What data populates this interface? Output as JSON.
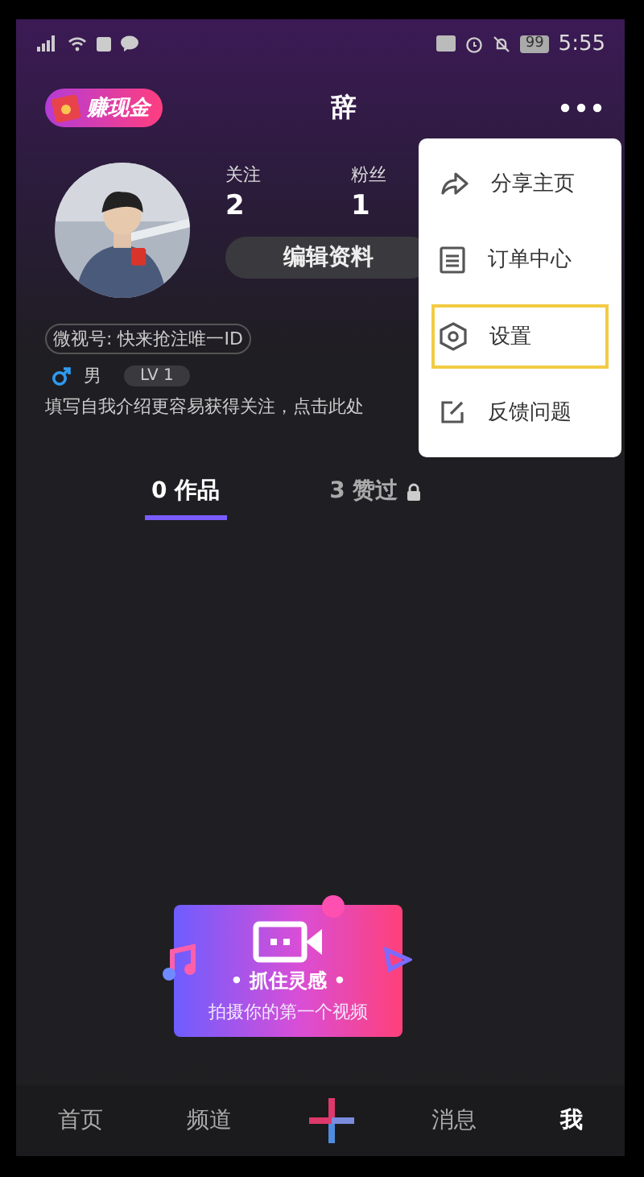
{
  "status_bar": {
    "battery": "99",
    "time": "5:55"
  },
  "header": {
    "badge": "赚现金",
    "title": "辞"
  },
  "profile": {
    "stats": [
      {
        "label": "关注",
        "value": "2"
      },
      {
        "label": "粉丝",
        "value": "1"
      }
    ],
    "edit_button": "编辑资料",
    "id_label": "微视号: 快来抢注唯一ID",
    "gender": "男",
    "level_badge": "LV 1",
    "bio": "填写自我介绍更容易获得关注，点击此处"
  },
  "tabs": [
    {
      "label": "0 作品",
      "selected": true,
      "locked": false
    },
    {
      "label": "3 赞过",
      "selected": false,
      "locked": true
    }
  ],
  "menu": [
    {
      "label": "分享主页",
      "kind": "share",
      "selected": false
    },
    {
      "label": "订单中心",
      "kind": "orders",
      "selected": false
    },
    {
      "label": "设置",
      "kind": "settings",
      "selected": true
    },
    {
      "label": "反馈问题",
      "kind": "feedback",
      "selected": false
    }
  ],
  "prompt": {
    "title": "• 抓住灵感 •",
    "subtitle": "拍摄你的第一个视频"
  },
  "nav": [
    {
      "kind": "text",
      "label": "首页",
      "selected": false
    },
    {
      "kind": "text",
      "label": "频道",
      "selected": false
    },
    {
      "kind": "plus",
      "selected": false
    },
    {
      "kind": "text",
      "label": "消息",
      "selected": false
    },
    {
      "kind": "text",
      "label": "我",
      "selected": true
    }
  ]
}
